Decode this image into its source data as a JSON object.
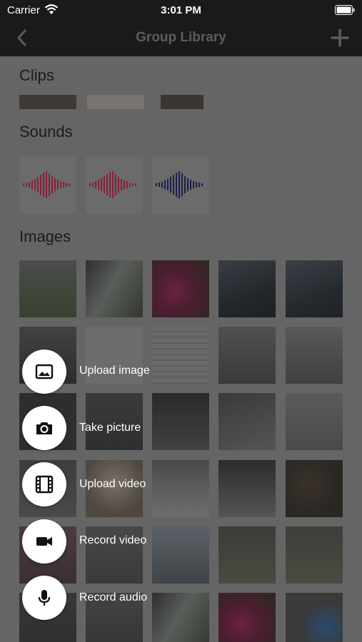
{
  "status": {
    "carrier": "Carrier",
    "time": "3:01 PM"
  },
  "nav": {
    "title": "Group Library"
  },
  "sections": {
    "clips": "Clips",
    "sounds": "Sounds",
    "images": "Images"
  },
  "icons": {
    "back": "chevron-left-icon",
    "add": "plus-icon",
    "wifi": "wifi-icon",
    "battery": "battery-icon"
  },
  "colors": {
    "sound_waveform_1": "#8c1f3a",
    "sound_waveform_2": "#8c1f3a",
    "sound_waveform_3": "#1d1f4a",
    "action_button_bg": "#ffffff"
  },
  "actions": [
    {
      "label": "Upload image",
      "icon": "image-icon"
    },
    {
      "label": "Take picture",
      "icon": "camera-icon"
    },
    {
      "label": "Upload video",
      "icon": "film-icon"
    },
    {
      "label": "Record video",
      "icon": "video-camera-icon"
    },
    {
      "label": "Record audio",
      "icon": "microphone-icon"
    }
  ]
}
